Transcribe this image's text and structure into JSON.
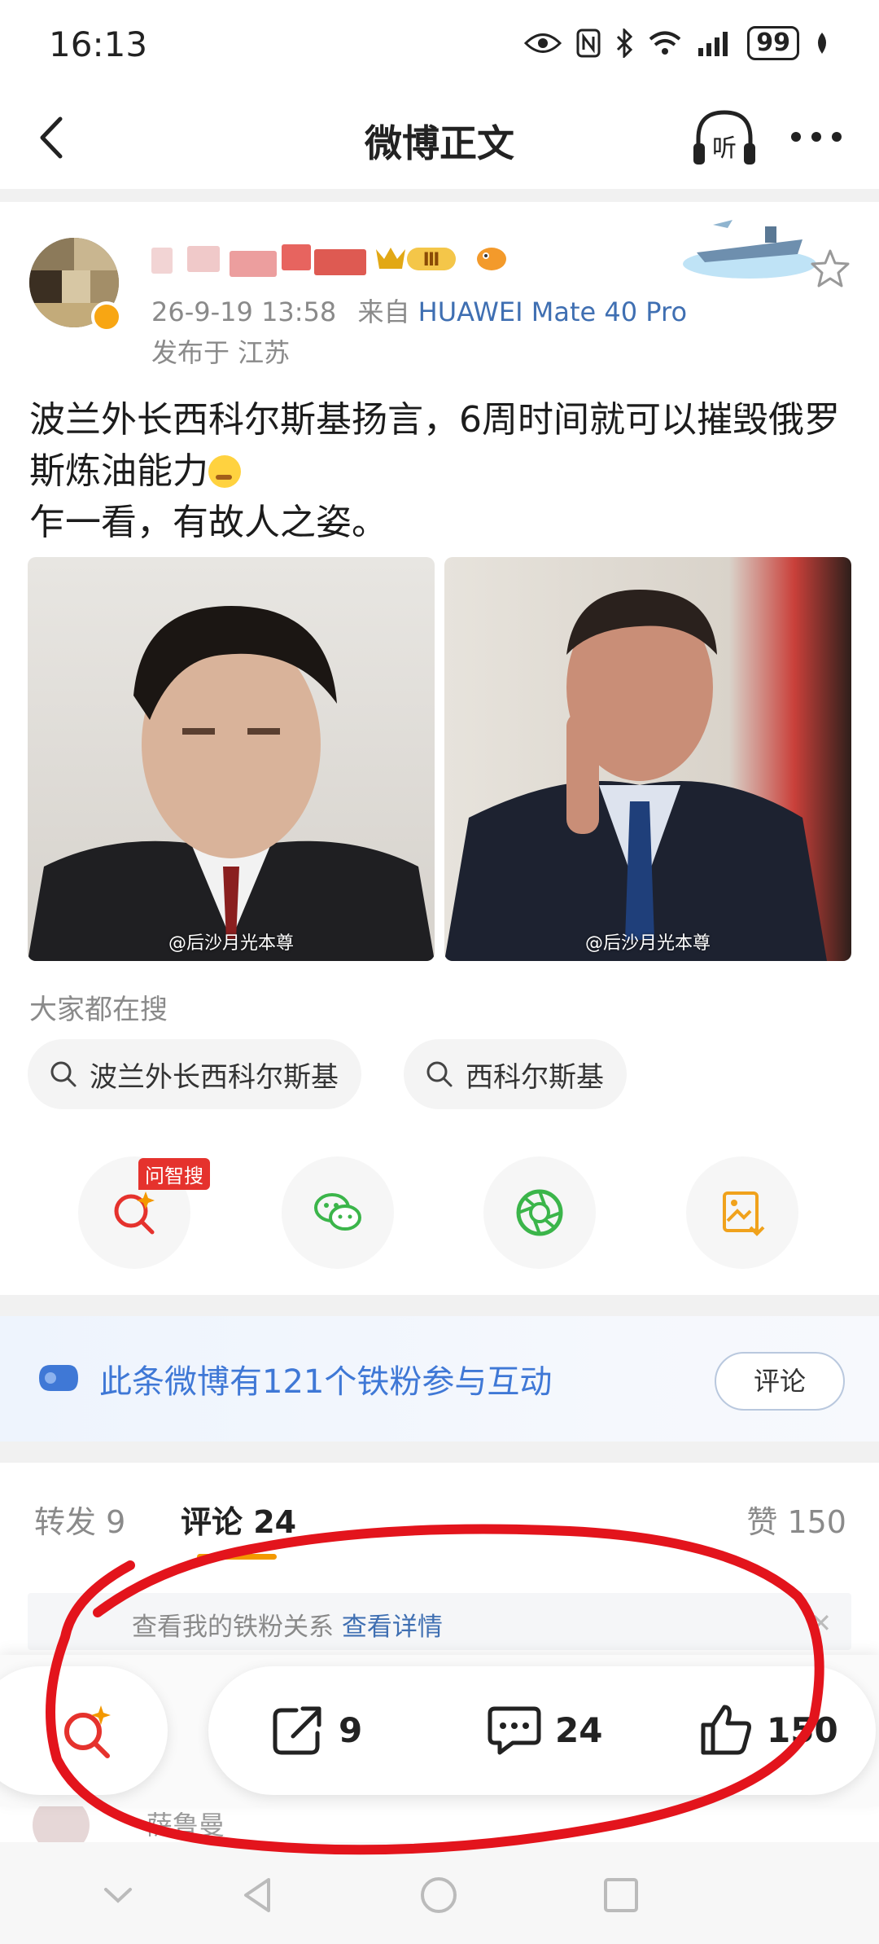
{
  "status_bar": {
    "time": "16:13",
    "battery": "99"
  },
  "nav": {
    "title": "微博正文",
    "listen_label": "听"
  },
  "post": {
    "timestamp": "26-9-19 13:58",
    "source_prefix": "来自",
    "device": "HUAWEI Mate 40 Pro",
    "location": "发布于 江苏",
    "vip_level": "Ⅲ",
    "text_line1": "波兰外长西科尔斯基扬言，6周时间就可以摧毁俄罗斯炼油能力",
    "text_line2": "乍一看，有故人之姿。",
    "images": [
      {
        "watermark": "@后沙月光本尊"
      },
      {
        "watermark": "@后沙月光本尊"
      }
    ]
  },
  "search": {
    "title": "大家都在搜",
    "chips": [
      "波兰外长西科尔斯基",
      "西科尔斯基"
    ]
  },
  "share": {
    "ai_tag": "问智搜"
  },
  "fans_banner": {
    "text": "此条微博有121个铁粉参与互动",
    "button": "评论"
  },
  "tabs": {
    "repost": "转发 9",
    "comment": "评论 24",
    "like": "赞 150"
  },
  "fan_notice": {
    "text": "查看我的铁粉关系",
    "link": "查看详情"
  },
  "comment_preview": {
    "name": "萨鲁曼"
  },
  "bottom_bar": {
    "repost_count": "9",
    "comment_count": "24",
    "like_count": "150"
  },
  "colors": {
    "accent_orange": "#f39800",
    "link_blue": "#3f6fb2",
    "annotation_red": "#e3141c"
  }
}
